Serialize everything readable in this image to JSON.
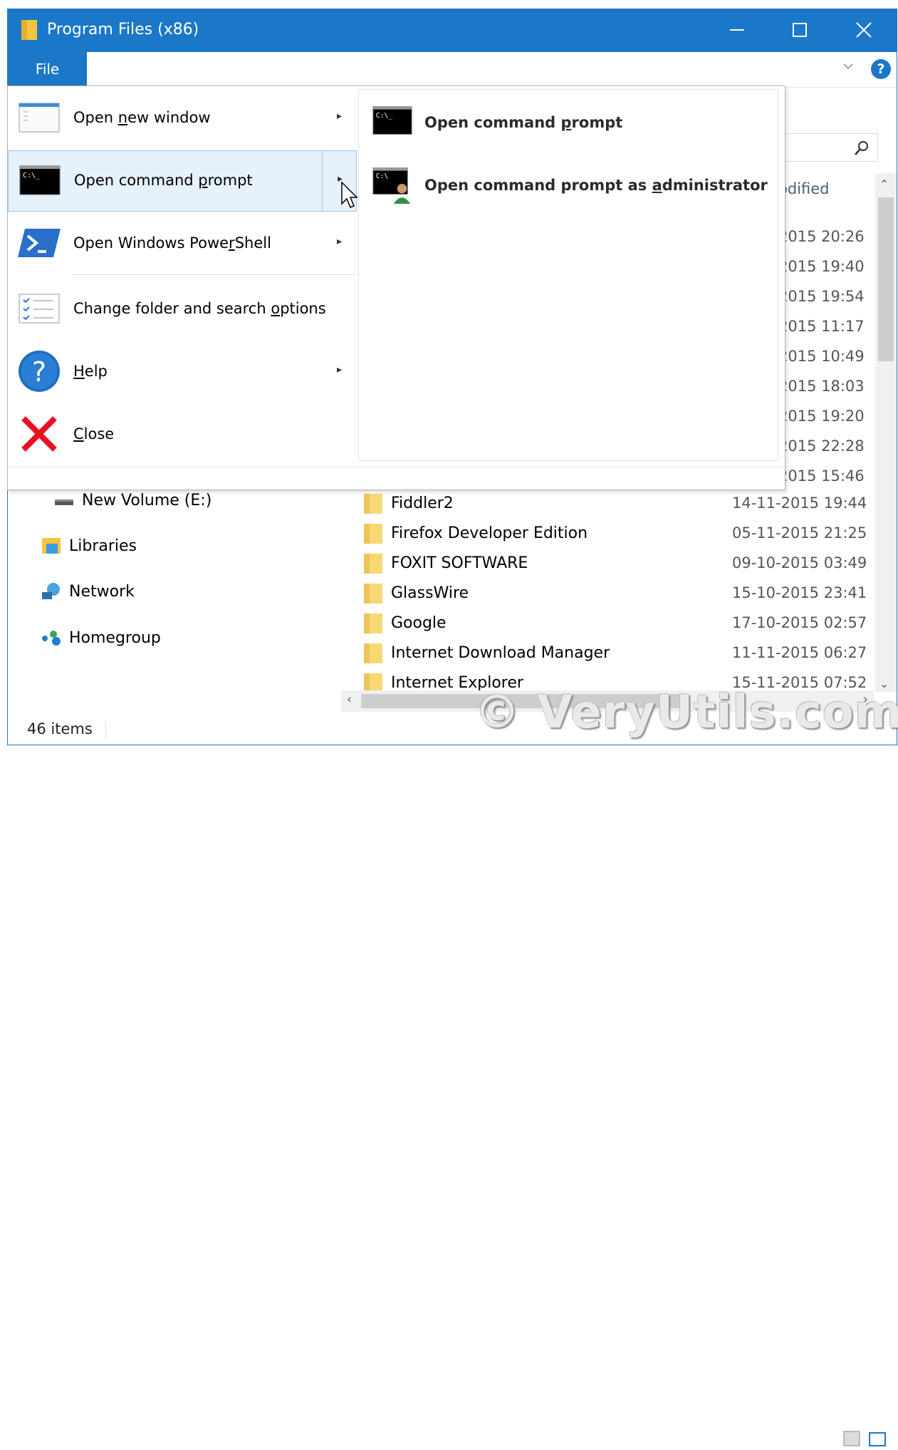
{
  "window": {
    "title": "Program Files (x86)",
    "minimize_glyph": "—",
    "maximize_glyph": "☐",
    "close_glyph": "✕"
  },
  "ribbon": {
    "file_tab": "File",
    "chevron_glyph": "⌄",
    "help_glyph": "?"
  },
  "search": {
    "icon": "search-icon",
    "glyph": "⚲"
  },
  "columns": {
    "date_modified_partial": "odified"
  },
  "background_dates": [
    "2015 20:26",
    "2015 19:40",
    "2015 19:54",
    "2015 11:17",
    "2015 10:49",
    "2015 18:03",
    "2015 19:20",
    "2015 22:28",
    "2015 15:46"
  ],
  "nav": {
    "items": [
      {
        "label": "New Volume (E:)",
        "icon": "drive-icon"
      },
      {
        "label": "Libraries",
        "icon": "libraries-icon"
      },
      {
        "label": "Network",
        "icon": "network-icon"
      },
      {
        "label": "Homegroup",
        "icon": "homegroup-icon"
      }
    ]
  },
  "files": [
    {
      "name": "Fiddler2",
      "date": "14-11-2015 19:44"
    },
    {
      "name": "Firefox Developer Edition",
      "date": "05-11-2015 21:25"
    },
    {
      "name": "FOXIT SOFTWARE",
      "date": "09-10-2015 03:49"
    },
    {
      "name": "GlassWire",
      "date": "15-10-2015 23:41"
    },
    {
      "name": "Google",
      "date": "17-10-2015 02:57"
    },
    {
      "name": "Internet Download Manager",
      "date": "11-11-2015 06:27"
    },
    {
      "name": "Internet Explorer",
      "date": "15-11-2015 07:52"
    }
  ],
  "status": {
    "item_count": "46 items"
  },
  "watermark": "© VeryUtils.com",
  "file_menu": {
    "items": [
      {
        "label": "Open new window",
        "icon": "window-icon",
        "submenu": true
      },
      {
        "label": "Open command prompt",
        "icon": "cmd-icon",
        "submenu": true,
        "highlighted": true
      },
      {
        "label": "Open Windows PowerShell",
        "icon": "powershell-icon",
        "submenu": true
      },
      {
        "label": "Change folder and search options",
        "icon": "options-icon",
        "submenu": false
      },
      {
        "label": "Help",
        "icon": "help-icon",
        "submenu": true
      },
      {
        "label": "Close",
        "icon": "close-red-icon",
        "submenu": false
      }
    ],
    "arrow_glyph": "▸",
    "cmd_prompt_text": "C:\\_"
  },
  "submenu": {
    "items": [
      {
        "label": "Open command prompt",
        "icon": "cmd-icon"
      },
      {
        "label": "Open command prompt as administrator",
        "icon": "cmd-admin-icon"
      }
    ]
  },
  "scrollbars": {
    "up": "⌃",
    "down": "⌄",
    "left": "‹",
    "right": "›"
  },
  "colors": {
    "accent": "#1b78c8",
    "highlight": "#e5f1fb",
    "highlight_border": "#99c8f2",
    "close_red": "#e81123"
  }
}
